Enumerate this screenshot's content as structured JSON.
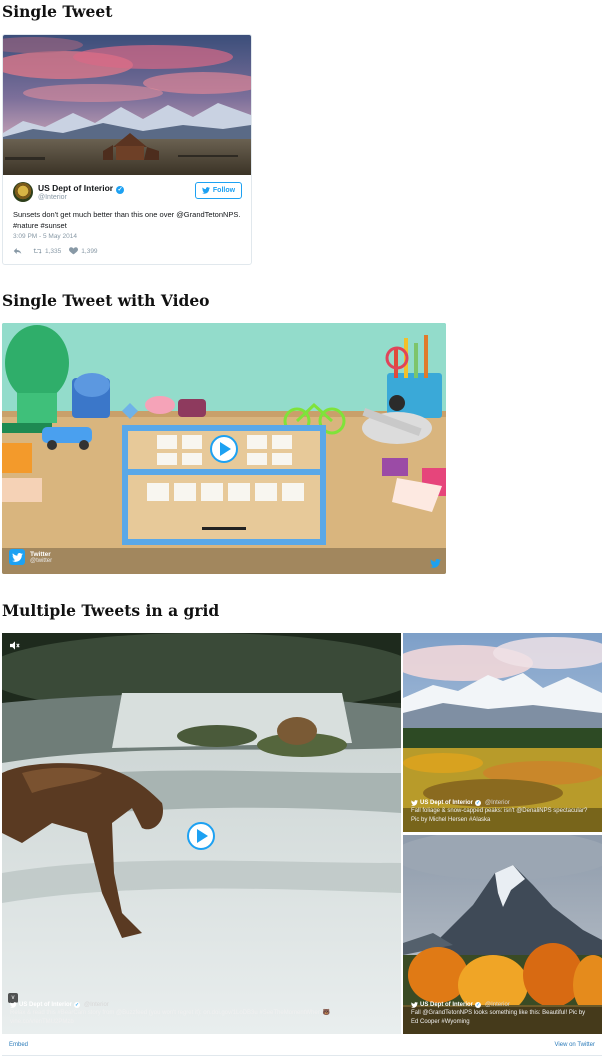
{
  "sections": {
    "single_tweet": "Single Tweet",
    "video_tweet": "Single Tweet with Video",
    "grid": "Multiple Tweets in a grid"
  },
  "tweet": {
    "display_name": "US Dept of Interior",
    "handle": "@Interior",
    "follow_label": "Follow",
    "text": "Sunsets don't get much better than this one over @GrandTetonNPS. #nature #sunset",
    "time": "3:09 PM - 5 May 2014",
    "retweets": "1,335",
    "likes": "1,399"
  },
  "video_tweet": {
    "brand_name": "Twitter",
    "brand_handle": "@twitter"
  },
  "grid": {
    "tiles": [
      {
        "name": "US Dept of Interior",
        "handle": "@Interior",
        "text": "Relax & read this #BearCam story from @Buzzfeed (you won't regret it): on.doi.gov/1LoDB3u #SeeTheMomentWhen 🐻 vine.co/v/enTMU2PMzb"
      },
      {
        "name": "US Dept of Interior",
        "handle": "@Interior",
        "text": "Fall foliage & snow-capped peaks: isn't @DenaliNPS spectacular? Pic by Michel Hersen #Alaska"
      },
      {
        "name": "US Dept of Interior",
        "handle": "@Interior",
        "text": "Fall @GrandTetonNPS looks something like this: Beautiful! Pic by Ed Cooper #Wyoming"
      }
    ],
    "embed_label": "Embed",
    "view_label": "View on Twitter"
  },
  "colors": {
    "twitter_blue": "#1da1f2",
    "link_blue": "#2b7bb9",
    "muted_text": "#8899a6"
  },
  "icons": [
    "twitter-bird-icon",
    "verified-icon",
    "reply-icon",
    "retweet-icon",
    "like-icon",
    "play-icon",
    "mute-icon",
    "vine-icon"
  ]
}
